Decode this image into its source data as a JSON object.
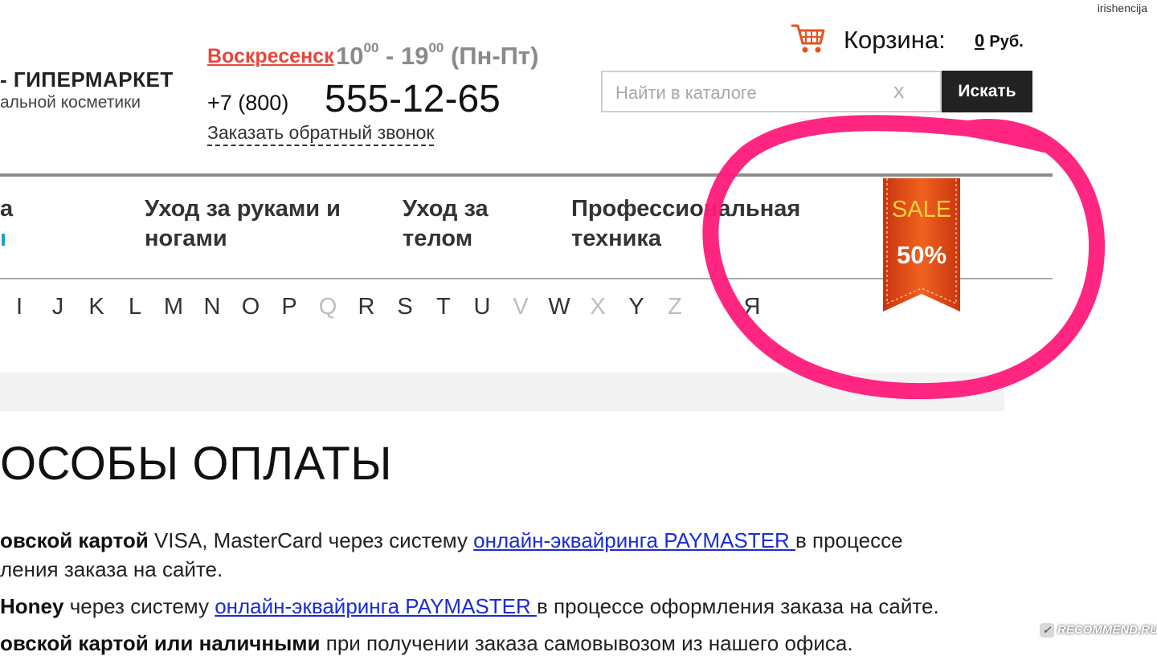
{
  "watermark_user": "irishencija",
  "logo": {
    "title": "- ГИПЕРМАРКЕТ",
    "subtitle": "альной косметики"
  },
  "contacts": {
    "city": "Воскресенск",
    "hours_start": "10",
    "hours_start_sup": "00",
    "hours_sep": " - ",
    "hours_end": "19",
    "hours_end_sup": "00",
    "days": " (Пн-Пт)",
    "phone_prefix": "+7 (800)",
    "phone_main": "555-12-65",
    "callback": "Заказать обратный звонок"
  },
  "cart": {
    "label": "Корзина:",
    "amount": "0",
    "currency": "Руб."
  },
  "search": {
    "placeholder": "Найти в каталоге",
    "clear": "x",
    "button": "Искать"
  },
  "categories": [
    {
      "line1": "а",
      "line2": ""
    },
    {
      "line1": "Уход за руками и",
      "line2": "ногами"
    },
    {
      "line1": "Уход за",
      "line2": "телом"
    },
    {
      "line1": "Профессиональная",
      "line2": "техника"
    }
  ],
  "sale": {
    "label": "SALE",
    "percent": "50%"
  },
  "alphabet": [
    {
      "ch": "I",
      "dim": false
    },
    {
      "ch": "J",
      "dim": false
    },
    {
      "ch": "K",
      "dim": false
    },
    {
      "ch": "L",
      "dim": false
    },
    {
      "ch": "M",
      "dim": false
    },
    {
      "ch": "N",
      "dim": false
    },
    {
      "ch": "O",
      "dim": false
    },
    {
      "ch": "P",
      "dim": false
    },
    {
      "ch": "Q",
      "dim": true
    },
    {
      "ch": "R",
      "dim": false
    },
    {
      "ch": "S",
      "dim": false
    },
    {
      "ch": "T",
      "dim": false
    },
    {
      "ch": "U",
      "dim": false
    },
    {
      "ch": "V",
      "dim": true
    },
    {
      "ch": "W",
      "dim": false
    },
    {
      "ch": "X",
      "dim": true
    },
    {
      "ch": "Y",
      "dim": false
    },
    {
      "ch": "Z",
      "dim": true
    },
    {
      "ch": "",
      "dim": true
    },
    {
      "ch": "Я",
      "dim": false
    }
  ],
  "content": {
    "title": "ОСОБЫ ОПЛАТЫ",
    "line1_bold": "овской картой",
    "line1_text": " VISA, MasterCard через систему ",
    "line1_link": "онлайн-эквайринга PAYMASTER ",
    "line1_tail": " в процессе",
    "line1b_text": "ления заказа на сайте.",
    "line2_bold": "Honey",
    "line2_text": " через систему ",
    "line2_link": "онлайн-эквайринга PAYMASTER ",
    "line2_tail": " в процессе оформления заказа на сайте.",
    "line3_bold": "овской картой или наличными",
    "line3_text": " при получении заказа самовывозом из нашего офиса."
  },
  "recommend_watermark": "RECOMMEND.RU",
  "colors": {
    "accent_red": "#e8463b",
    "link_blue": "#1a2bd6",
    "marker_pink": "#ff1a7a",
    "sale_orange": "#e8501e"
  }
}
